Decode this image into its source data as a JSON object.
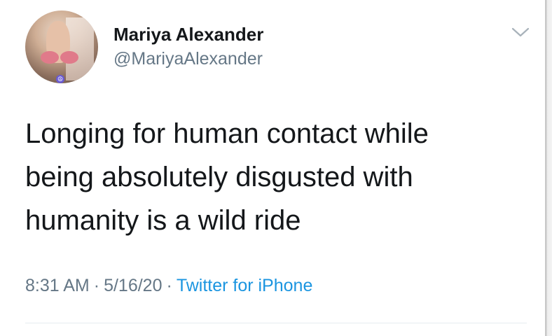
{
  "user": {
    "display_name": "Mariya Alexander",
    "handle": "@MariyaAlexander"
  },
  "tweet": {
    "lines": [
      "Longing for human contact while",
      "being absolutely disgusted with",
      "humanity is a wild ride"
    ]
  },
  "meta": {
    "time": "8:31 AM",
    "separator": "·",
    "date": "5/16/20",
    "source": "Twitter for iPhone"
  },
  "icons": {
    "menu": "chevron-down-icon",
    "badge": "peace-sign-icon"
  },
  "colors": {
    "text_primary": "#14171a",
    "text_secondary": "#657786",
    "link": "#1b95e0"
  }
}
